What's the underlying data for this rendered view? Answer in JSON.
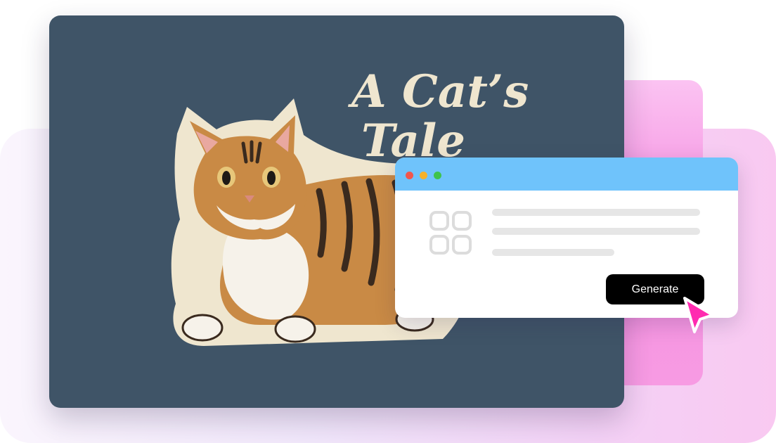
{
  "artwork": {
    "title_line1": "A Cat’s",
    "title_line2": "Tale",
    "icon": "cat-sticker-illustration"
  },
  "window": {
    "controls": [
      "close-icon",
      "minimize-icon",
      "maximize-icon"
    ],
    "placeholder_icon": "grid-icon",
    "generate_label": "Generate"
  },
  "cursor": {
    "icon": "pointer-cursor-icon"
  },
  "colors": {
    "card_bg": "#3f5467",
    "titlebar": "#6fc3fb",
    "button": "#000000",
    "cursor": "#ff2bb0",
    "accent_pink": "#f58fe0"
  }
}
